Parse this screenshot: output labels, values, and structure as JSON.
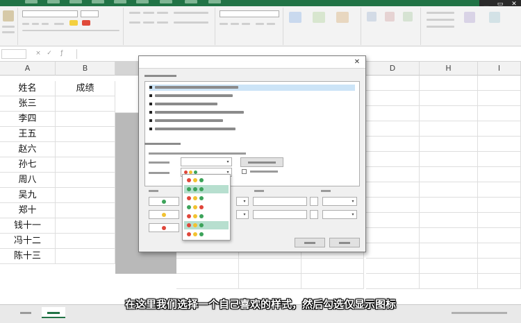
{
  "grid": {
    "columns": [
      "A",
      "B",
      "D",
      "H",
      "I"
    ],
    "header_row": [
      "姓名",
      "成绩"
    ],
    "names": [
      "张三",
      "李四",
      "王五",
      "赵六",
      "孙七",
      "周八",
      "吴九",
      "郑十",
      "钱十一",
      "冯十二",
      "陈十三"
    ]
  },
  "subtitle": "在这里我们选择一个自己喜欢的样式，然后勾选仅显示图标",
  "colors": {
    "accent": "#217346",
    "selection": "#b9b9b9",
    "icon_red": "#e0463a",
    "icon_yellow": "#f2c230",
    "icon_green": "#3ca35a"
  },
  "icons": [
    "chevron-down-icon",
    "close-icon",
    "traffic-light-icon"
  ]
}
